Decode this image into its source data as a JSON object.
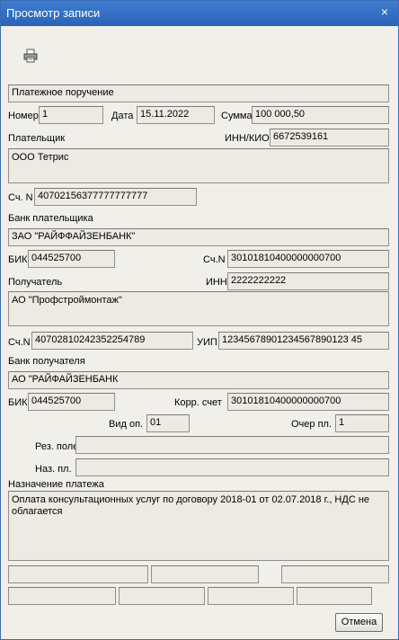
{
  "window": {
    "title": "Просмотр записи",
    "close_glyph": "×"
  },
  "toolbar": {
    "print_icon": "printer-icon"
  },
  "doc": {
    "type": "Платежное поручение",
    "number_label": "Номер",
    "number": "1",
    "date_label": "Дата",
    "date": "15.11.2022",
    "sum_label": "Сумма",
    "sum": "100 000,50"
  },
  "payer": {
    "label": "Плательщик",
    "inn_label": "ИНН/КИО",
    "inn": "6672539161",
    "name": "ООО Тетрис",
    "account_label": "Сч. N",
    "account": "40702156377777777777",
    "bank_label": "Банк плательщика",
    "bank_name": "ЗАО \"РАЙФФАЙЗЕНБАНК\"",
    "bik_label": "БИК",
    "bik": "044525700",
    "corr_label": "Сч.N",
    "corr_account": "30101810400000000700"
  },
  "receiver": {
    "label": "Получатель",
    "inn_label": "ИНН",
    "inn": "2222222222",
    "name": "АО \"Профстроймонтаж\"",
    "account_label": "Сч.N",
    "account": "40702810242352254789",
    "uip_label": "УИП",
    "uip": "12345678901234567890123 45",
    "bank_label": "Банк получателя",
    "bank_name": "АО \"РАЙФАЙЗЕНБАНК",
    "bik_label": "БИК",
    "bik": "044525700",
    "corr_label": "Корр. счет",
    "corr_account": "30101810400000000700"
  },
  "operation": {
    "vid_label": "Вид оп.",
    "vid": "01",
    "ocher_label": "Очер пл.",
    "ocher": "1",
    "rez_label": "Рез. поле",
    "rez": "",
    "naz_label": "Наз. пл.",
    "naz": ""
  },
  "purpose": {
    "label": "Назначение платежа",
    "text": "Оплата консультационных услуг по договору 2018-01 от 02.07.2018 г., НДС не облагается"
  },
  "buttons": {
    "cancel": "Отмена"
  }
}
